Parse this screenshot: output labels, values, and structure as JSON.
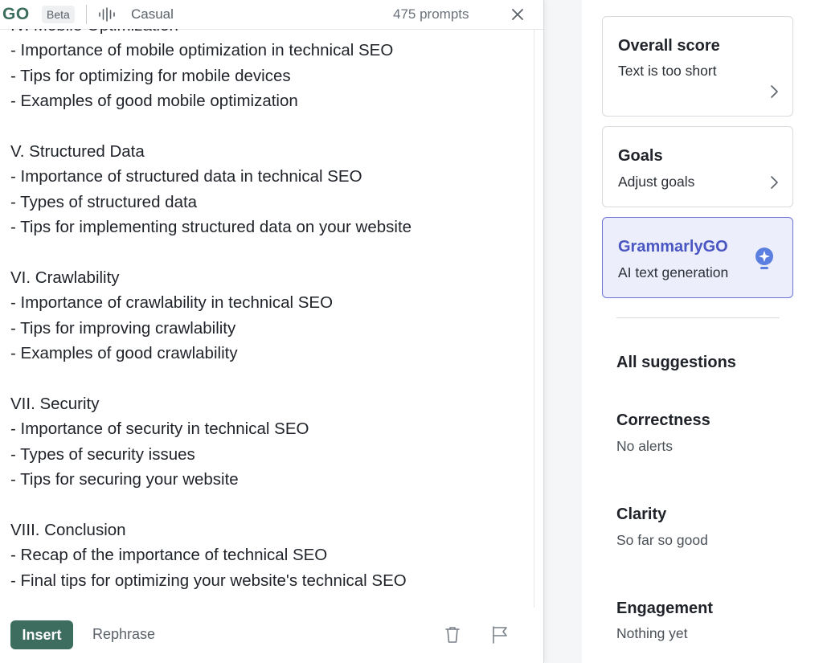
{
  "header": {
    "logo": "GO",
    "badge": "Beta",
    "voice_icon": "audio-waveform-icon",
    "voice": "Casual",
    "prompts": "475 prompts",
    "close_icon": "close-icon"
  },
  "content": {
    "lines": [
      "IV. Mobile Optimization",
      "- Importance of mobile optimization in technical SEO",
      "- Tips for optimizing for mobile devices",
      "- Examples of good mobile optimization",
      "",
      "V. Structured Data",
      "- Importance of structured data in technical SEO",
      "- Types of structured data",
      "- Tips for implementing structured data on your website",
      "",
      "VI. Crawlability",
      "- Importance of crawlability in technical SEO",
      "- Tips for improving crawlability",
      "- Examples of good crawlability",
      "",
      "VII. Security",
      "- Importance of security in technical SEO",
      "- Types of security issues",
      "- Tips for securing your website",
      "",
      "VIII. Conclusion",
      "- Recap of the importance of technical SEO",
      "- Final tips for optimizing your website's technical SEO"
    ]
  },
  "footer": {
    "insert": "Insert",
    "rephrase": "Rephrase",
    "trash_icon": "trash-icon",
    "flag_icon": "flag-icon"
  },
  "sidebar": {
    "overall": {
      "title": "Overall score",
      "subtitle": "Text is too short"
    },
    "goals": {
      "title": "Goals",
      "subtitle": "Adjust goals"
    },
    "grammarlygo": {
      "title": "GrammarlyGO",
      "subtitle": "AI text generation",
      "icon": "lightbulb-sparkle-icon"
    },
    "all_suggestions": "All suggestions",
    "categories": [
      {
        "title": "Correctness",
        "status": "No alerts"
      },
      {
        "title": "Clarity",
        "status": "So far so good"
      },
      {
        "title": "Engagement",
        "status": "Nothing yet"
      }
    ]
  },
  "colors": {
    "go_green": "#3d6d5f",
    "go_purple": "#4a56c2",
    "go_card_bg": "#eceefb",
    "bulb_blue": "#5b7fe0"
  }
}
